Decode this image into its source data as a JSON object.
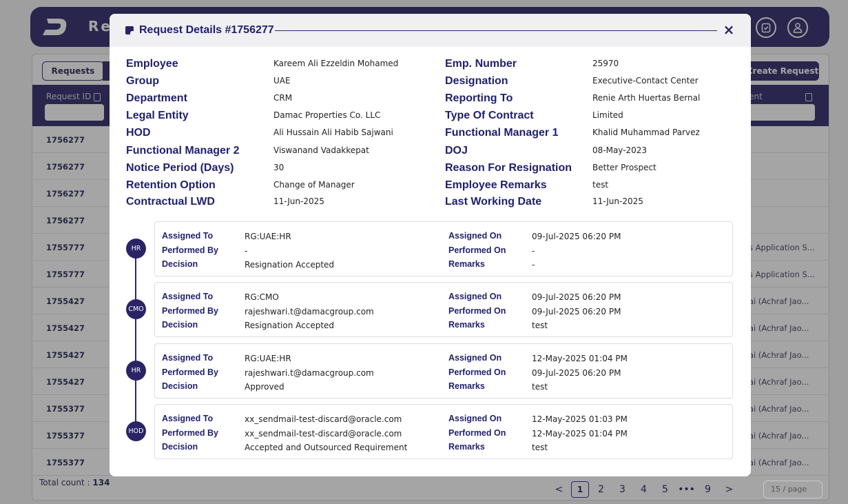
{
  "app": {
    "title_partial": "Res"
  },
  "toolbar": {
    "tab_requests": "Requests",
    "create_request": "Create Request"
  },
  "table": {
    "header_request_id": "Request ID",
    "header_right_partial": "ent",
    "rows": [
      {
        "id": "1756277",
        "right": ""
      },
      {
        "id": "1756277",
        "right": ""
      },
      {
        "id": "1756277",
        "right": ""
      },
      {
        "id": "1756277",
        "right": ""
      },
      {
        "id": "1755777",
        "right": "s Application S..."
      },
      {
        "id": "1755777",
        "right": "s Application S..."
      },
      {
        "id": "1755427",
        "right": "ai (Achraf Jao..."
      },
      {
        "id": "1755427",
        "right": "ai (Achraf Jao..."
      },
      {
        "id": "1755427",
        "right": "ai (Achraf Jao..."
      },
      {
        "id": "1755427",
        "right": "ai (Achraf Jao..."
      },
      {
        "id": "1755377",
        "right": "ai (Achraf Jao..."
      },
      {
        "id": "1755377",
        "right": "ai (Achraf Jao..."
      },
      {
        "id": "1755377",
        "right": "ai (Achraf Jao..."
      }
    ],
    "total_label": "Total count : ",
    "total_value": "134"
  },
  "pagination": {
    "prev": "<",
    "pages": [
      "1",
      "2",
      "3",
      "4",
      "5",
      "•••",
      "9"
    ],
    "next": ">",
    "page_size": "15 / page"
  },
  "modal": {
    "title": "Request Details #1756277",
    "close": "×",
    "left_fields": [
      {
        "label": "Employee",
        "value": "Kareem Ali Ezzeldin Mohamed"
      },
      {
        "label": "Group",
        "value": "UAE"
      },
      {
        "label": "Department",
        "value": "CRM"
      },
      {
        "label": "Legal Entity",
        "value": "Damac Properties Co. LLC"
      },
      {
        "label": "HOD",
        "value": "Ali Hussain Ali Habib Sajwani"
      },
      {
        "label": "Functional Manager 2",
        "value": "Viswanand Vadakkepat"
      },
      {
        "label": "Notice Period (Days)",
        "value": "30"
      },
      {
        "label": "Retention Option",
        "value": "Change of Manager"
      },
      {
        "label": "Contractual LWD",
        "value": "11-Jun-2025"
      }
    ],
    "right_fields": [
      {
        "label": "Emp. Number",
        "value": "25970"
      },
      {
        "label": "Designation",
        "value": "Executive-Contact Center"
      },
      {
        "label": "Reporting To",
        "value": "Renie Arth Huertas Bernal"
      },
      {
        "label": "Type Of Contract",
        "value": "Limited"
      },
      {
        "label": "Functional Manager 1",
        "value": "Khalid Muhammad Parvez"
      },
      {
        "label": "DOJ",
        "value": "08-May-2023"
      },
      {
        "label": "Reason For Resignation",
        "value": "Better Prospect"
      },
      {
        "label": "Employee Remarks",
        "value": "test"
      },
      {
        "label": "Last Working Date",
        "value": "11-Jun-2025"
      }
    ],
    "labels": {
      "assigned_to": "Assigned To",
      "performed_by": "Performed By",
      "decision": "Decision",
      "assigned_on": "Assigned On",
      "performed_on": "Performed On",
      "remarks": "Remarks"
    },
    "timeline": [
      {
        "badge": "HR",
        "assigned_to": "RG:UAE:HR",
        "performed_by": "-",
        "decision": "Resignation Accepted",
        "assigned_on": "09-Jul-2025 06:20 PM",
        "performed_on": "-",
        "remarks": "-"
      },
      {
        "badge": "CMO",
        "assigned_to": "RG:CMO",
        "performed_by": "rajeshwari.t@damacgroup.com",
        "decision": "Resignation Accepted",
        "assigned_on": "09-Jul-2025 06:20 PM",
        "performed_on": "09-Jul-2025 06:20 PM",
        "remarks": "test"
      },
      {
        "badge": "HR",
        "assigned_to": "RG:UAE:HR",
        "performed_by": "rajeshwari.t@damacgroup.com",
        "decision": "Approved",
        "assigned_on": "12-May-2025 01:04 PM",
        "performed_on": "09-Jul-2025 06:20 PM",
        "remarks": "test"
      },
      {
        "badge": "HOD",
        "assigned_to": "xx_sendmail-test-discard@oracle.com",
        "performed_by": "xx_sendmail-test-discard@oracle.com",
        "decision": "Accepted and Outsourced Requirement",
        "assigned_on": "12-May-2025 01:03 PM",
        "performed_on": "12-May-2025 01:04 PM",
        "remarks": "test"
      }
    ]
  },
  "colors": {
    "brand": "#2a2466",
    "title": "#1f1f6e"
  },
  "icons": {
    "logo": "d-logo",
    "topbar_1": "clipboard-icon",
    "topbar_2": "user-icon",
    "modal_header": "note-icon",
    "close": "close-icon",
    "sort": "sort-icon"
  }
}
